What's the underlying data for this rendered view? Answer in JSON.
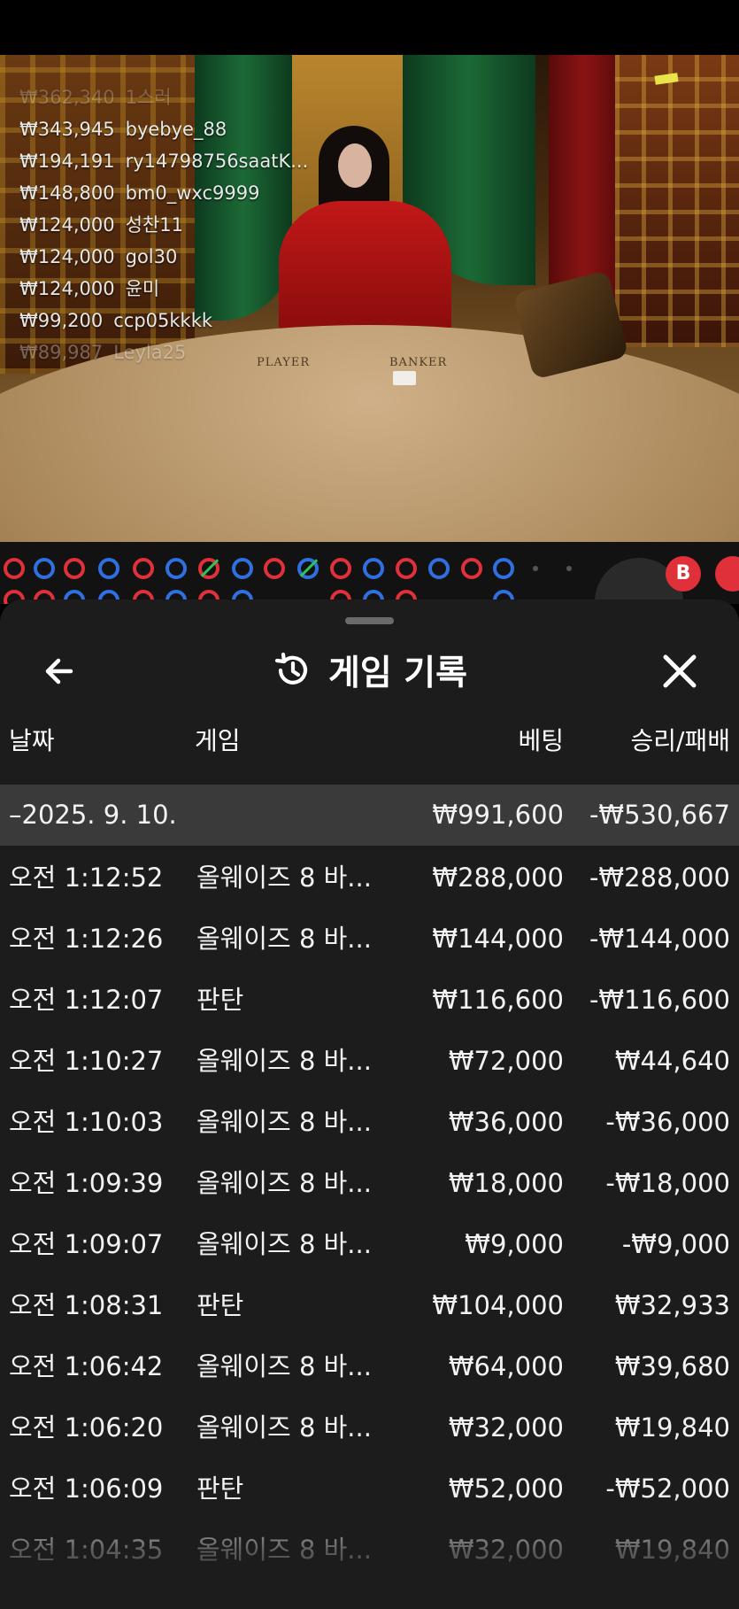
{
  "stream": {
    "leaderboard": [
      {
        "amount": "₩362,340",
        "name": "1스러"
      },
      {
        "amount": "₩343,945",
        "name": "byebye_88"
      },
      {
        "amount": "₩194,191",
        "name": "ry14798756saatK..."
      },
      {
        "amount": "₩148,800",
        "name": "bm0_wxc9999"
      },
      {
        "amount": "₩124,000",
        "name": "성찬11"
      },
      {
        "amount": "₩124,000",
        "name": "gol30"
      },
      {
        "amount": "₩124,000",
        "name": "윤미"
      },
      {
        "amount": "₩99,200",
        "name": "ccp05kkkk"
      },
      {
        "amount": "₩89,987",
        "name": "Leyla25"
      }
    ],
    "table_labels": {
      "player": "PLAYER",
      "banker": "BANKER"
    },
    "badge_label": "B"
  },
  "sheet": {
    "title": "게임 기록",
    "columns": {
      "date": "날짜",
      "game": "게임",
      "bet": "베팅",
      "result": "승리/패배"
    },
    "summary": {
      "date": "–2025. 9. 10.",
      "bet": "₩991,600",
      "result": "-₩530,667"
    },
    "rows": [
      {
        "time": "오전 1:12:52",
        "game": "올웨이즈 8 바...",
        "bet": "₩288,000",
        "result": "-₩288,000"
      },
      {
        "time": "오전 1:12:26",
        "game": "올웨이즈 8 바...",
        "bet": "₩144,000",
        "result": "-₩144,000"
      },
      {
        "time": "오전 1:12:07",
        "game": "판탄",
        "bet": "₩116,600",
        "result": "-₩116,600"
      },
      {
        "time": "오전 1:10:27",
        "game": "올웨이즈 8 바...",
        "bet": "₩72,000",
        "result": "₩44,640"
      },
      {
        "time": "오전 1:10:03",
        "game": "올웨이즈 8 바...",
        "bet": "₩36,000",
        "result": "-₩36,000"
      },
      {
        "time": "오전 1:09:39",
        "game": "올웨이즈 8 바...",
        "bet": "₩18,000",
        "result": "-₩18,000"
      },
      {
        "time": "오전 1:09:07",
        "game": "올웨이즈 8 바...",
        "bet": "₩9,000",
        "result": "-₩9,000"
      },
      {
        "time": "오전 1:08:31",
        "game": "판탄",
        "bet": "₩104,000",
        "result": "₩32,933"
      },
      {
        "time": "오전 1:06:42",
        "game": "올웨이즈 8 바...",
        "bet": "₩64,000",
        "result": "₩39,680"
      },
      {
        "time": "오전 1:06:20",
        "game": "올웨이즈 8 바...",
        "bet": "₩32,000",
        "result": "₩19,840"
      },
      {
        "time": "오전 1:06:09",
        "game": "판탄",
        "bet": "₩52,000",
        "result": "-₩52,000"
      },
      {
        "time": "오전 1:04:35",
        "game": "올웨이즈 8 바...",
        "bet": "₩32,000",
        "result": "₩19,840"
      }
    ],
    "icons": {
      "back": "arrow-left-icon",
      "title": "history-icon",
      "close": "close-icon"
    }
  },
  "colors": {
    "sheet_bg": "#1c1c1c",
    "summary_bg": "#3a3a3a",
    "player_blue": "#2f6fe0",
    "banker_red": "#e0303a",
    "tie_green": "#2ec45a"
  }
}
